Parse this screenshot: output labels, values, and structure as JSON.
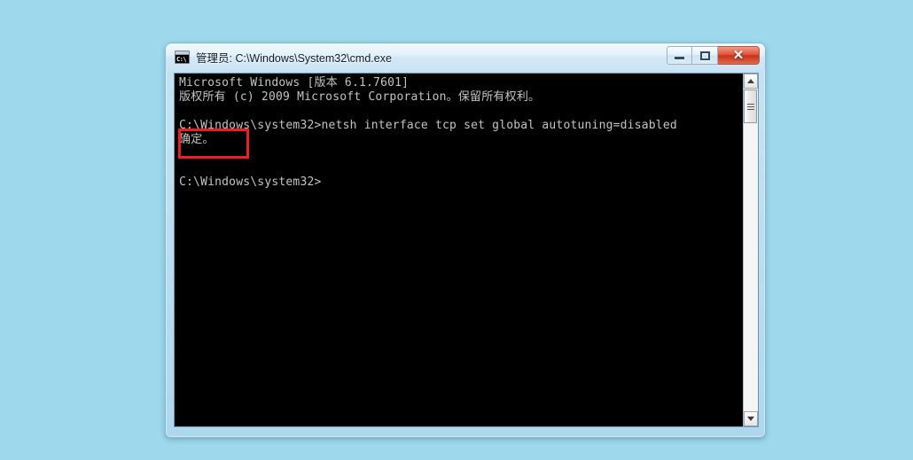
{
  "desktop": {
    "background_color": "#9ed8ec"
  },
  "window": {
    "title": "管理员: C:\\Windows\\System32\\cmd.exe",
    "icon_label": "C:\\",
    "icon_name": "cmd-exe-icon",
    "caption_buttons": {
      "minimize_label": "─",
      "maximize_label": "□",
      "close_label": "✕"
    },
    "frame_color": "#cde4f4",
    "close_button_color": "#c63317"
  },
  "console": {
    "background_color": "#000000",
    "text_color": "#c4c4c4",
    "lines": [
      "Microsoft Windows [版本 6.1.7601]",
      "版权所有 (c) 2009 Microsoft Corporation。保留所有权利。",
      "",
      "C:\\Windows\\system32>netsh interface tcp set global autotuning=disabled",
      "确定。",
      "",
      "",
      "C:\\Windows\\system32>"
    ]
  },
  "annotation": {
    "name": "red-highlight-box",
    "target_text": "确定。",
    "color": "#ee1c25"
  },
  "scrollbar": {
    "up_arrow": "▲",
    "down_arrow": "▼",
    "thumb_position": "top"
  }
}
